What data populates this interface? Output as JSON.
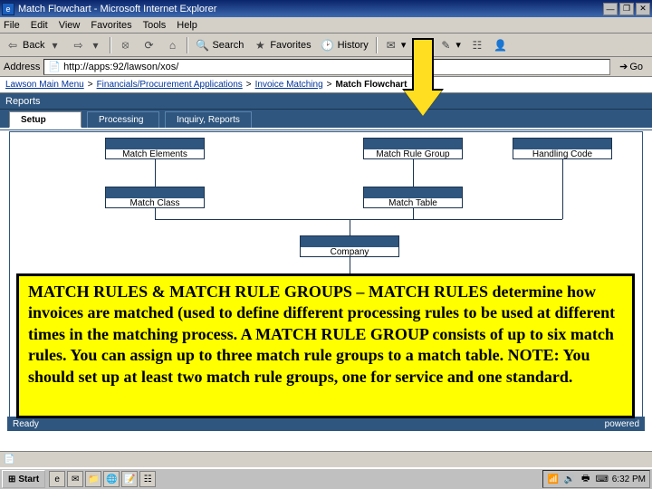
{
  "window": {
    "title": "Match Flowchart - Microsoft Internet Explorer",
    "min": "—",
    "max": "❐",
    "close": "✕",
    "restore": "❐"
  },
  "menu": [
    "File",
    "Edit",
    "View",
    "Favorites",
    "Tools",
    "Help"
  ],
  "toolbar": {
    "back": "Back",
    "forward": "",
    "stop": "",
    "refresh": "",
    "home": "",
    "search": "Search",
    "favorites": "Favorites",
    "history": "History",
    "mail": "",
    "print": "",
    "edit": "",
    "discuss": ""
  },
  "address": {
    "label": "Address",
    "url": "http://apps:92/lawson/xos/",
    "go": "Go"
  },
  "breadcrumb": {
    "root": "Lawson Main Menu",
    "items": [
      "Financials/Procurement Applications",
      "Invoice Matching"
    ],
    "current": "Match Flowchart"
  },
  "section_reports": "Reports",
  "tabs": [
    {
      "label": "Setup",
      "active": true
    },
    {
      "label": "Processing",
      "active": false
    },
    {
      "label": "Inquiry, Reports",
      "active": false
    }
  ],
  "nodes": {
    "match_elements": "Match Elements",
    "match_rule_group": "Match Rule Group",
    "handling_code": "Handling Code",
    "match_class": "Match Class",
    "match_table": "Match Table",
    "company": "Company"
  },
  "readybar": {
    "left": "Ready",
    "right": "powered"
  },
  "annotation": "MATCH RULES & MATCH RULE GROUPS – MATCH RULES determine how invoices are matched (used to define different processing rules to be used at different times in the matching process. A MATCH RULE GROUP consists of up to six match rules.  You can assign up to three match rule groups to a match table.  NOTE:  You should set up at least two match rule groups, one for service and one standard.",
  "taskbar": {
    "start": "Start",
    "clock": "6:32 PM"
  }
}
